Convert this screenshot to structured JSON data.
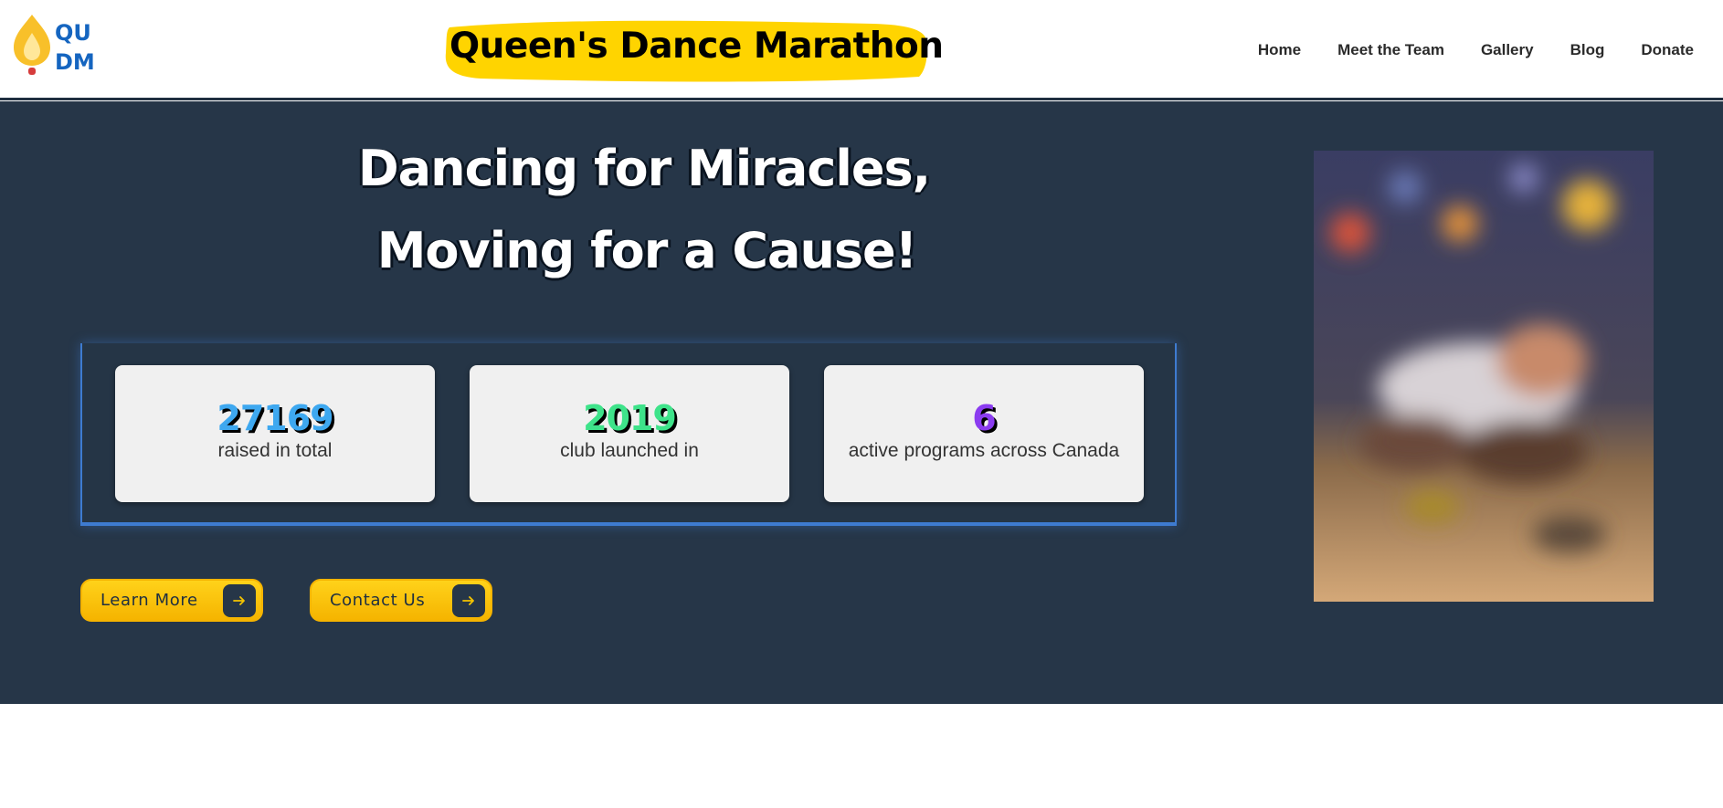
{
  "header": {
    "logo_text_line1": "QU",
    "logo_text_line2": "DM",
    "brand_title": "Queen's Dance Marathon",
    "nav": [
      {
        "label": "Home"
      },
      {
        "label": "Meet the Team"
      },
      {
        "label": "Gallery"
      },
      {
        "label": "Blog"
      },
      {
        "label": "Donate"
      }
    ]
  },
  "hero": {
    "title_line1": "Dancing for Miracles,",
    "title_line2": "Moving for a Cause!",
    "stats": [
      {
        "value": "27169",
        "label": "raised in total",
        "color": "#3ea8f0"
      },
      {
        "value": "2019",
        "label": "club launched in",
        "color": "#3ee38a"
      },
      {
        "value": "6",
        "label": "active programs across Canada",
        "color": "#8b3cf0"
      }
    ],
    "buttons": [
      {
        "label": "Learn More"
      },
      {
        "label": "Contact Us"
      }
    ]
  },
  "colors": {
    "hero_bg": "#263648",
    "accent_yellow": "#f5c400",
    "logo_blue": "#1565c0",
    "panel_glow": "#3e7bd0"
  },
  "icons": {
    "logo": "flame-logo-icon",
    "button_arrow": "arrow-right-icon"
  }
}
